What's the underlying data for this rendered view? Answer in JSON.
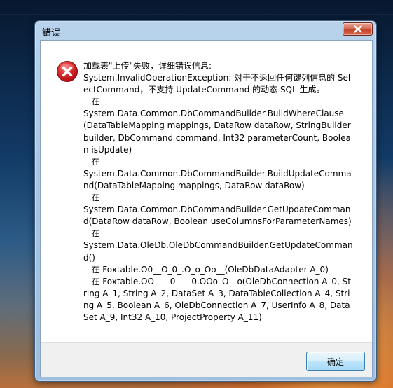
{
  "dialog": {
    "title": "错误",
    "close_icon": "close-icon",
    "error_icon": "error-x-icon",
    "message": "加载表\"上传\"失败，详细错误信息:\nSystem.InvalidOperationException: 对于不返回任何键列信息的 SelectCommand，不支持 UpdateCommand 的动态 SQL 生成。\n   在\nSystem.Data.Common.DbCommandBuilder.BuildWhereClause(DataTableMapping mappings, DataRow dataRow, StringBuilder builder, DbCommand command, Int32 parameterCount, Boolean isUpdate)\n   在\nSystem.Data.Common.DbCommandBuilder.BuildUpdateCommand(DataTableMapping mappings, DataRow dataRow)\n   在\nSystem.Data.Common.DbCommandBuilder.GetUpdateCommand(DataRow dataRow, Boolean useColumnsForParameterNames)\n   在\nSystem.Data.OleDb.OleDbCommandBuilder.GetUpdateCommand()\n   在 Foxtable.O0__O_0_.O_o_Oo__(OleDbDataAdapter A_0)\n   在 Foxtable.OO      0      0.OOo_O__o(OleDbConnection A_0, String A_1, String A_2, DataSet A_3, DataTableCollection A_4, String A_5, Boolean A_6, OleDbConnection A_7, UserInfo A_8, DataSet A_9, Int32 A_10, ProjectProperty A_11)",
    "ok_label": "确定"
  },
  "colors": {
    "error_red": "#c8141a",
    "window_frame": "#a6c6e5",
    "close_red": "#c4442b",
    "button_blue": "#bee6fd"
  }
}
